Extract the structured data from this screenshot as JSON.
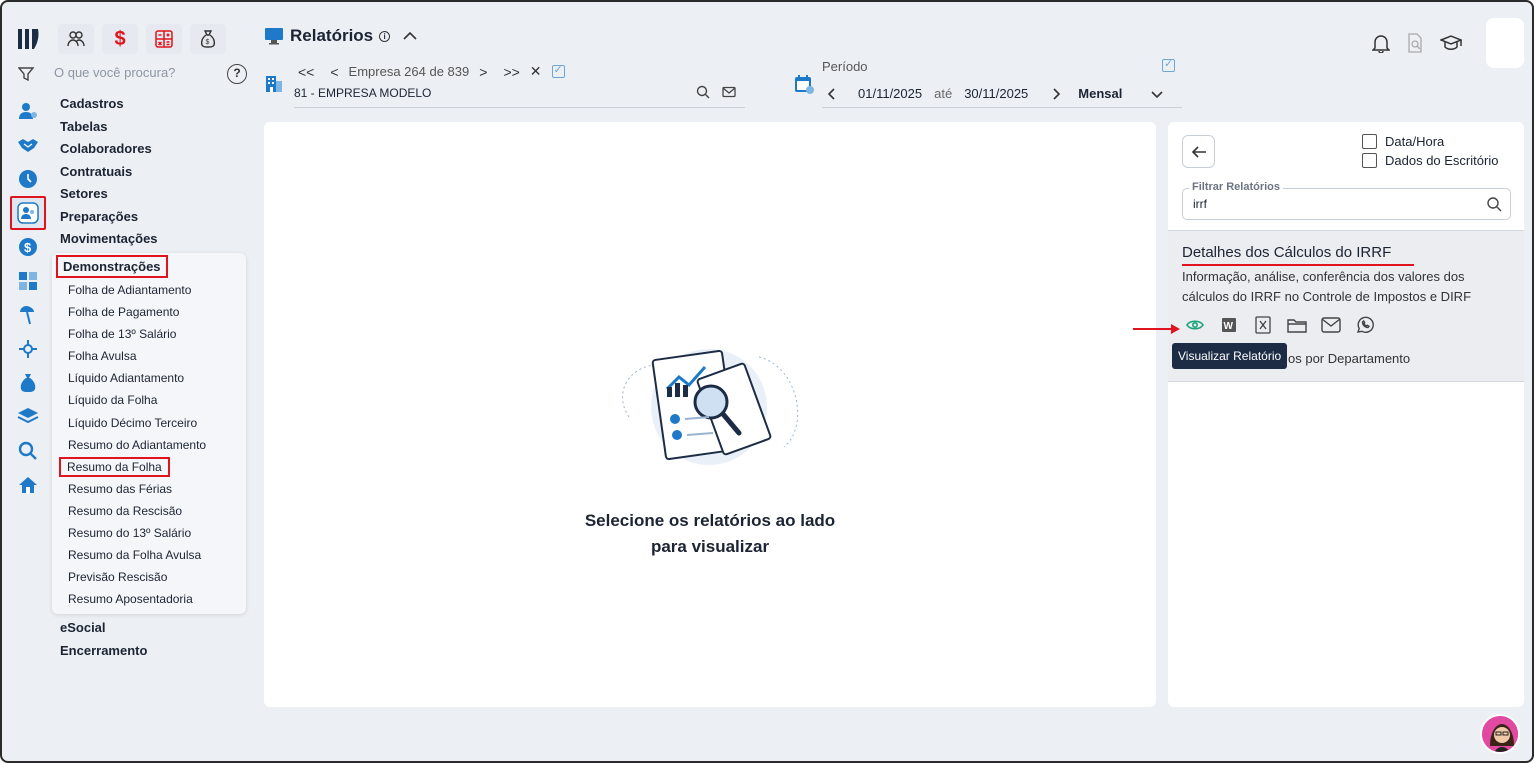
{
  "header": {
    "title": "Relatórios",
    "left_search_placeholder": "O que você procura?"
  },
  "company_nav": {
    "counter": "Empresa 264 de 839",
    "company": "81 - EMPRESA MODELO"
  },
  "period": {
    "label": "Período",
    "start": "01/11/2025",
    "between": "até",
    "end": "30/11/2025",
    "mode": "Mensal"
  },
  "sidebar": {
    "top_items": [
      "Cadastros",
      "Tabelas",
      "Colaboradores",
      "Contratuais",
      "Setores",
      "Preparações",
      "Movimentações"
    ],
    "open_group": "Demonstrações",
    "sub_items": [
      "Folha de Adiantamento",
      "Folha de Pagamento",
      "Folha de 13º Salário",
      "Folha Avulsa",
      "Líquido Adiantamento",
      "Líquido da Folha",
      "Líquido Décimo Terceiro",
      "Resumo do Adiantamento",
      "Resumo da Folha",
      "Resumo das Férias",
      "Resumo da Rescisão",
      "Resumo do 13º Salário",
      "Resumo da Folha Avulsa",
      "Previsão Rescisão",
      "Resumo Aposentadoria"
    ],
    "bottom_items": [
      "eSocial",
      "Encerramento"
    ]
  },
  "main": {
    "message_line1": "Selecione os relatórios ao lado",
    "message_line2": "para visualizar"
  },
  "right_panel": {
    "checkbox_datetime": "Data/Hora",
    "checkbox_office": "Dados do Escritório",
    "filter_label": "Filtrar Relatórios",
    "filter_value": "irrf",
    "result_title": "Detalhes dos Cálculos do IRRF",
    "result_desc": "Informação, análise, conferência dos valores dos cálculos do IRRF no Controle de Impostos e DIRF",
    "tooltip": "Visualizar Relatório",
    "second_result_partial": "os por Departamento"
  },
  "colors": {
    "accent_blue": "#1e7ac8",
    "highlight_red": "#e0141e",
    "dark_navy": "#1d2c45",
    "background": "#ecf0f5"
  }
}
